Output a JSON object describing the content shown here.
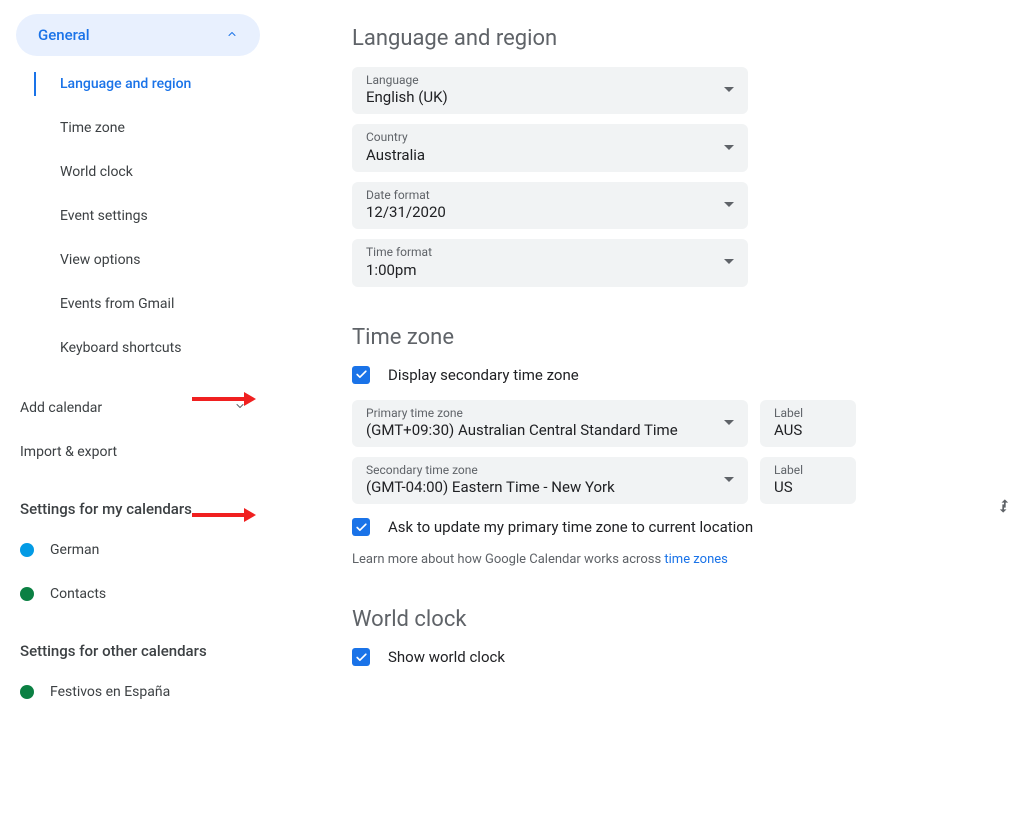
{
  "sidebar": {
    "general_label": "General",
    "items": [
      {
        "label": "Language and region"
      },
      {
        "label": "Time zone"
      },
      {
        "label": "World clock"
      },
      {
        "label": "Event settings"
      },
      {
        "label": "View options"
      },
      {
        "label": "Events from Gmail"
      },
      {
        "label": "Keyboard shortcuts"
      }
    ],
    "add_calendar": "Add calendar",
    "import_export": "Import & export",
    "my_cal_heading": "Settings for my calendars",
    "my_calendars": [
      {
        "label": "German",
        "color": "#039be5"
      },
      {
        "label": "Contacts",
        "color": "#0b8043"
      }
    ],
    "other_cal_heading": "Settings for other calendars",
    "other_calendars": [
      {
        "label": "Festivos en España",
        "color": "#0b8043"
      }
    ]
  },
  "lang_region": {
    "title": "Language and region",
    "language": {
      "label": "Language",
      "value": "English (UK)"
    },
    "country": {
      "label": "Country",
      "value": "Australia"
    },
    "date_fmt": {
      "label": "Date format",
      "value": "12/31/2020"
    },
    "time_fmt": {
      "label": "Time format",
      "value": "1:00pm"
    }
  },
  "timezone": {
    "title": "Time zone",
    "display_secondary": "Display secondary time zone",
    "primary": {
      "label": "Primary time zone",
      "value": "(GMT+09:30) Australian Central Standard Time",
      "tag_label": "Label",
      "tag_value": "AUS"
    },
    "secondary": {
      "label": "Secondary time zone",
      "value": "(GMT-04:00) Eastern Time - New York",
      "tag_label": "Label",
      "tag_value": "US"
    },
    "ask_update": "Ask to update my primary time zone to current location",
    "hint_prefix": "Learn more about how Google Calendar works across ",
    "hint_link": "time zones"
  },
  "world_clock": {
    "title": "World clock",
    "show": "Show world clock"
  },
  "colors": {
    "blue": "#1a73e8"
  }
}
